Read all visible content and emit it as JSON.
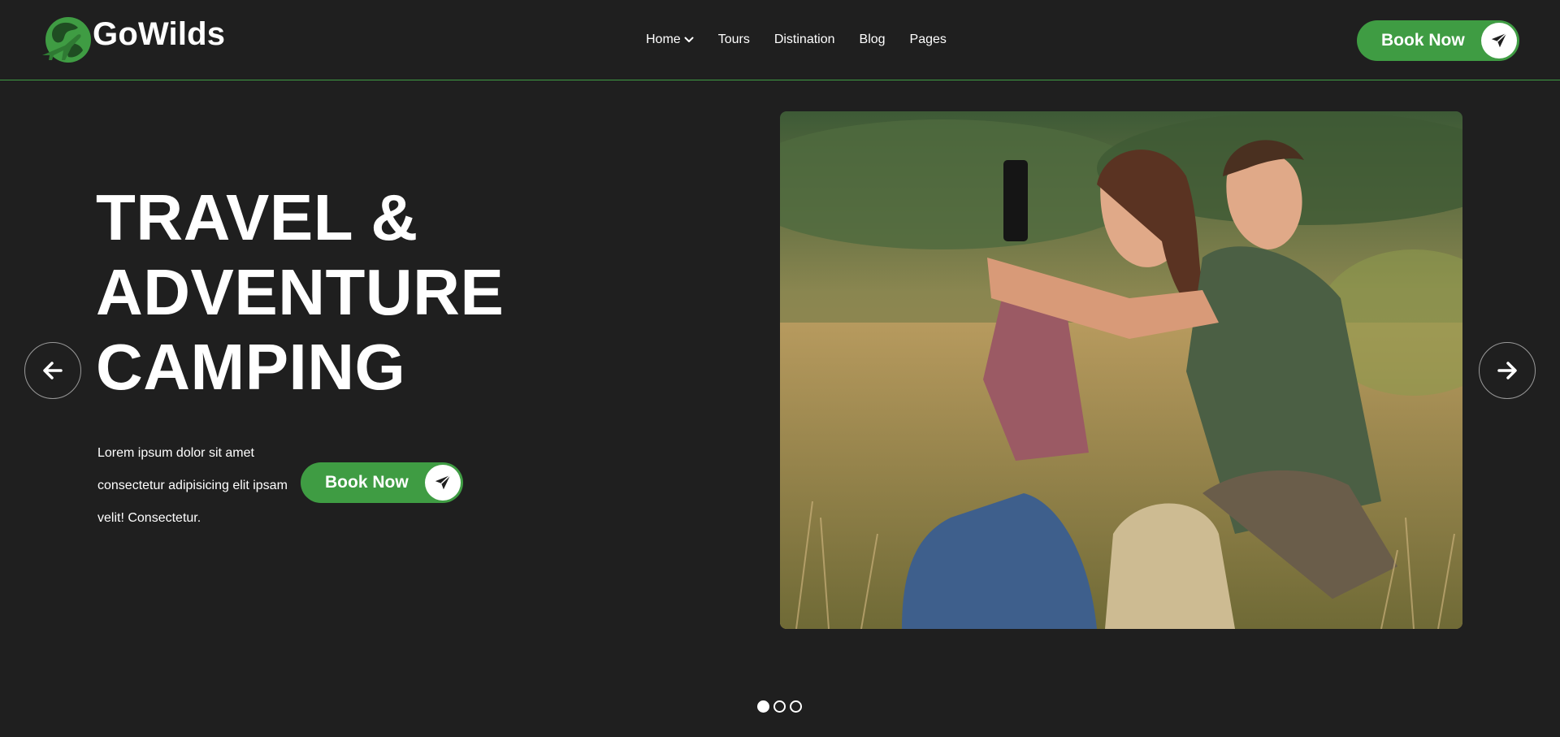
{
  "brand": {
    "name": "GoWilds"
  },
  "nav": {
    "items": [
      {
        "label": "Home",
        "has_dropdown": true
      },
      {
        "label": "Tours"
      },
      {
        "label": "Distination"
      },
      {
        "label": "Blog"
      },
      {
        "label": "Pages"
      }
    ]
  },
  "header": {
    "cta_label": "Book Now"
  },
  "hero": {
    "title_lines": [
      "TRAVEL &",
      "ADVENTURE",
      "CAMPING"
    ],
    "description": "Lorem ipsum dolor sit amet consectetur adipisicing elit ipsam velit! Consectetur.",
    "cta_label": "Book Now"
  },
  "slider": {
    "total_slides": 3,
    "active_slide": 1,
    "prev_icon": "arrow-left-icon",
    "next_icon": "arrow-right-icon"
  },
  "colors": {
    "background": "#1f1f1f",
    "accent": "#3f9c43",
    "text": "#ffffff"
  }
}
